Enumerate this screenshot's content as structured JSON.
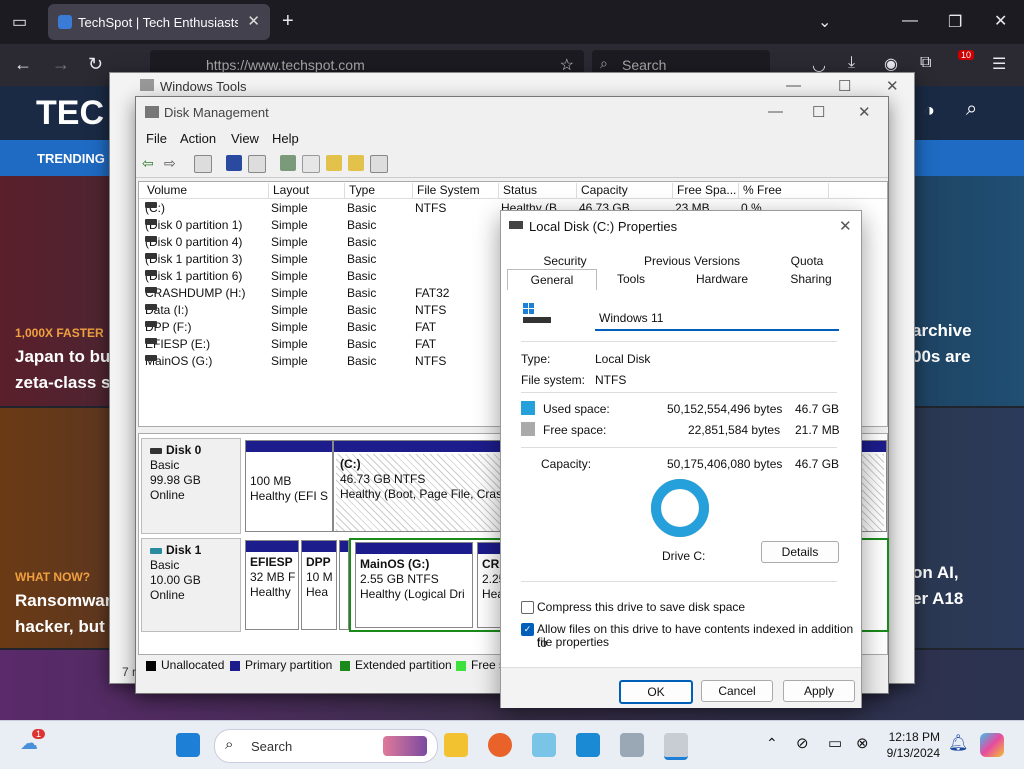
{
  "browser": {
    "tab_title": "TechSpot | Tech Enthusiasts, Po",
    "url": "https://www.techspot.com",
    "search_placeholder": "Search",
    "extension_badge": "10"
  },
  "site": {
    "logo": "TEC",
    "trending": "TRENDING",
    "kicker1": "1,000X FASTER",
    "headline1a": "Japan to bu",
    "headline1b": "zeta-class s",
    "right1a": "archive",
    "right1b": "00s are",
    "kicker2": "WHAT NOW?",
    "headline2a": "Ransomwar",
    "headline2b": "hacker, but c",
    "right2a": "on AI,",
    "right2b": "er A18"
  },
  "windows_tools": {
    "title": "Windows Tools"
  },
  "disk_management": {
    "title": "Disk Management",
    "menu": [
      "File",
      "Action",
      "View",
      "Help"
    ],
    "columns": [
      "Volume",
      "Layout",
      "Type",
      "File System",
      "Status",
      "Capacity",
      "Free Spa...",
      "% Free"
    ],
    "rows": [
      {
        "volume": "(C:)",
        "layout": "Simple",
        "type": "Basic",
        "fs": "NTFS",
        "status": "Healthy (B...",
        "capacity": "46.73 GB",
        "free": "23 MB",
        "pct": "0 %"
      },
      {
        "volume": "(Disk 0 partition 1)",
        "layout": "Simple",
        "type": "Basic",
        "fs": "",
        "status": "",
        "capacity": "",
        "free": "",
        "pct": ""
      },
      {
        "volume": "(Disk 0 partition 4)",
        "layout": "Simple",
        "type": "Basic",
        "fs": "",
        "status": "",
        "capacity": "",
        "free": "",
        "pct": ""
      },
      {
        "volume": "(Disk 1 partition 3)",
        "layout": "Simple",
        "type": "Basic",
        "fs": "",
        "status": "",
        "capacity": "",
        "free": "",
        "pct": ""
      },
      {
        "volume": "(Disk 1 partition 6)",
        "layout": "Simple",
        "type": "Basic",
        "fs": "",
        "status": "",
        "capacity": "",
        "free": "",
        "pct": ""
      },
      {
        "volume": "CRASHDUMP (H:)",
        "layout": "Simple",
        "type": "Basic",
        "fs": "FAT32",
        "status": "",
        "capacity": "",
        "free": "",
        "pct": ""
      },
      {
        "volume": "Data (I:)",
        "layout": "Simple",
        "type": "Basic",
        "fs": "NTFS",
        "status": "",
        "capacity": "",
        "free": "",
        "pct": ""
      },
      {
        "volume": "DPP (F:)",
        "layout": "Simple",
        "type": "Basic",
        "fs": "FAT",
        "status": "",
        "capacity": "",
        "free": "",
        "pct": ""
      },
      {
        "volume": "EFIESP (E:)",
        "layout": "Simple",
        "type": "Basic",
        "fs": "FAT",
        "status": "",
        "capacity": "",
        "free": "",
        "pct": ""
      },
      {
        "volume": "MainOS (G:)",
        "layout": "Simple",
        "type": "Basic",
        "fs": "NTFS",
        "status": "",
        "capacity": "",
        "free": "",
        "pct": ""
      }
    ],
    "disk0": {
      "name": "Disk 0",
      "type": "Basic",
      "size": "99.98 GB",
      "state": "Online",
      "p1_size": "100 MB",
      "p1_status": "Healthy (EFI S",
      "c_label": "(C:)",
      "c_size": "46.73 GB NTFS",
      "c_status": "Healthy (Boot, Page File, Crash"
    },
    "disk1": {
      "name": "Disk 1",
      "type": "Basic",
      "size": "10.00 GB",
      "state": "Online",
      "efi_label": "EFIESP",
      "efi_size": "32 MB F",
      "efi_status": "Healthy",
      "dpp_label": "DPP",
      "dpp_size": "10 M",
      "dpp_status": "Hea",
      "main_label": "MainOS  (G:)",
      "main_size": "2.55 GB NTFS",
      "main_status": "Healthy (Logical Dri",
      "cra_label": "CRA",
      "cra_size": "2.25",
      "cra_status": "Hea"
    },
    "legend": [
      "Unallocated",
      "Primary partition",
      "Extended partition",
      "Free s"
    ],
    "status_left": "7 r"
  },
  "properties": {
    "title": "Local Disk (C:) Properties",
    "tabs_row1": [
      "Security",
      "Previous Versions",
      "Quota"
    ],
    "tabs_row2": [
      "General",
      "Tools",
      "Hardware",
      "Sharing"
    ],
    "name_value": "Windows 11",
    "type_label": "Type:",
    "type_value": "Local Disk",
    "fs_label": "File system:",
    "fs_value": "NTFS",
    "used_label": "Used space:",
    "used_bytes": "50,152,554,496 bytes",
    "used_gb": "46.7 GB",
    "free_label": "Free space:",
    "free_bytes": "22,851,584 bytes",
    "free_gb": "21.7 MB",
    "cap_label": "Capacity:",
    "cap_bytes": "50,175,406,080 bytes",
    "cap_gb": "46.7 GB",
    "drive_label": "Drive C:",
    "details_btn": "Details",
    "compress_label": "Compress this drive to save disk space",
    "index_label": "Allow files on this drive to have contents indexed in addition to",
    "index_label2": "file properties",
    "ok": "OK",
    "cancel": "Cancel",
    "apply": "Apply",
    "used_fraction": 0.9995,
    "used_color": "#26a0da",
    "free_color": "#aaaaaa"
  },
  "taskbar": {
    "search": "Search",
    "time": "12:18 PM",
    "date": "9/13/2024",
    "weather_badge": "1"
  }
}
